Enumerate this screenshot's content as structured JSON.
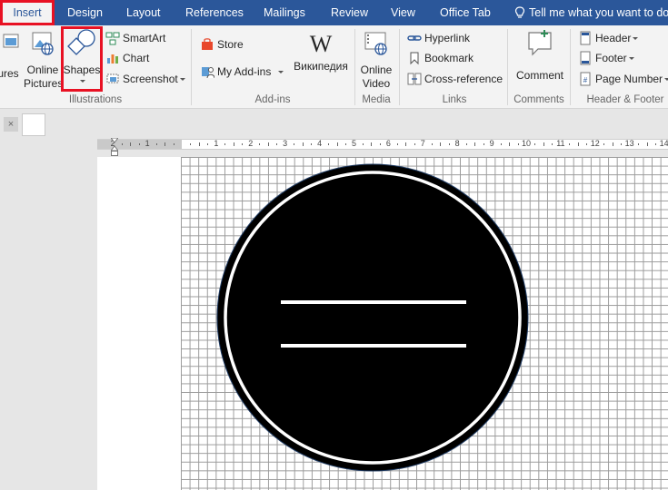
{
  "tabs": [
    {
      "label": "Insert",
      "active": true
    },
    {
      "label": "Design"
    },
    {
      "label": "Layout"
    },
    {
      "label": "References"
    },
    {
      "label": "Mailings"
    },
    {
      "label": "Review"
    },
    {
      "label": "View"
    },
    {
      "label": "Office Tab"
    }
  ],
  "tell_me": "Tell me what you want to do",
  "ribbon": {
    "illustrations": {
      "pictures_label": "ures",
      "online_pictures_label": "Online Pictures",
      "shapes_label": "Shapes",
      "smartart_label": "SmartArt",
      "chart_label": "Chart",
      "screenshot_label": "Screenshot",
      "group_label": "Illustrations"
    },
    "addins": {
      "store_label": "Store",
      "my_addins_label": "My Add-ins",
      "wikipedia_label": "Википедия",
      "group_label": "Add-ins"
    },
    "media": {
      "online_video_label": "Online Video",
      "group_label": "Media"
    },
    "links": {
      "hyperlink_label": "Hyperlink",
      "bookmark_label": "Bookmark",
      "crossref_label": "Cross-reference",
      "group_label": "Links"
    },
    "comments": {
      "comment_label": "Comment",
      "group_label": "Comments"
    },
    "header_footer": {
      "header_label": "Header",
      "footer_label": "Footer",
      "page_number_label": "Page Number",
      "group_label": "Header & Footer"
    }
  },
  "doc_tab_close": "×",
  "ruler": {
    "numbers": [
      "2",
      "1",
      "1",
      "2",
      "3",
      "4",
      "5",
      "6",
      "7",
      "8",
      "9",
      "10",
      "11",
      "12",
      "13",
      "14"
    ]
  },
  "colors": {
    "accent": "#2b579a",
    "highlight": "#e81123",
    "ribbon_bg": "#f3f3f3"
  }
}
